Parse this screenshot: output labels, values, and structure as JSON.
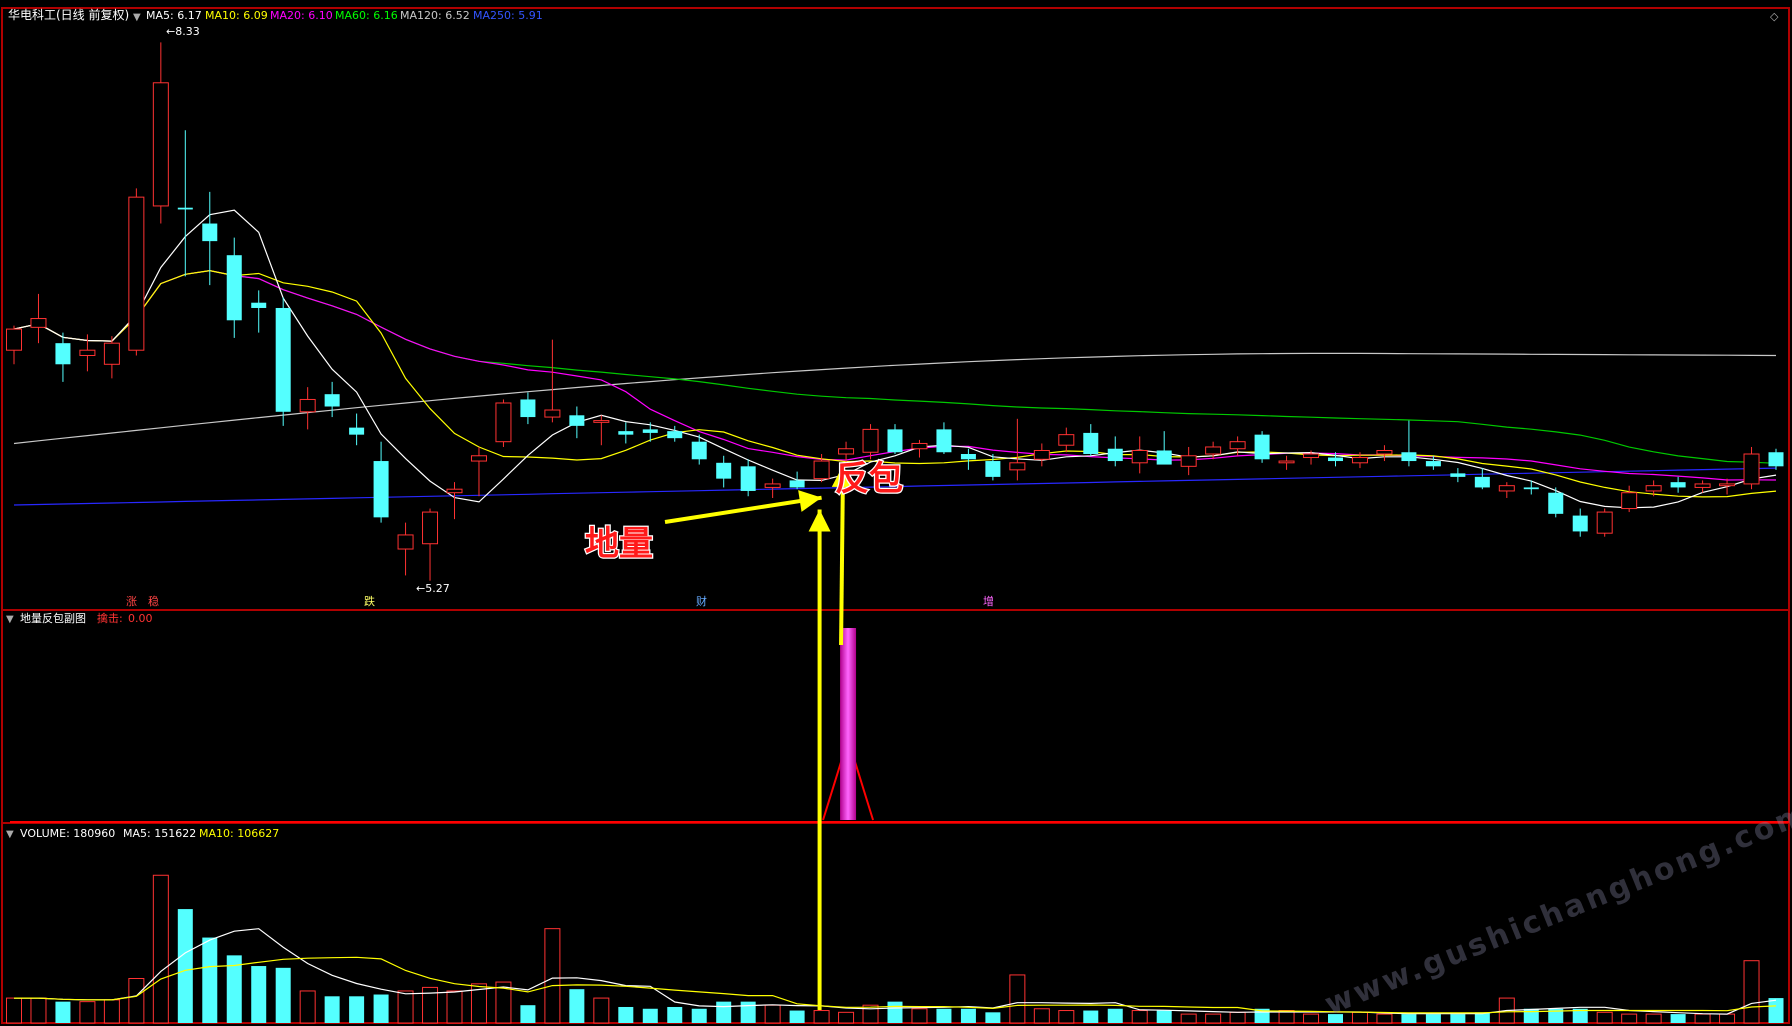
{
  "main_panel": {
    "stock_name": "华电科工(日线 前复权)",
    "ma_values": [
      {
        "label": "MA5: 6.17",
        "color": "#ffffff"
      },
      {
        "label": "MA10: 6.09",
        "color": "#ffff00"
      },
      {
        "label": "MA20: 6.10",
        "color": "#ff00ff"
      },
      {
        "label": "MA60: 6.16",
        "color": "#00ff00"
      },
      {
        "label": "MA120: 6.52",
        "color": "#c8c8c8"
      },
      {
        "label": "MA250: 5.91",
        "color": "#3355ff"
      }
    ],
    "high_label": "8.33",
    "low_label": "5.27",
    "event_marks": [
      "涨",
      "稳",
      "跌",
      "财",
      "增"
    ]
  },
  "indicator_panel": {
    "title": "地量反包副图",
    "field_label": "擒击:",
    "field_value": "0.00"
  },
  "volume_panel": {
    "volume_label": "VOLUME: 180960",
    "ma5_label": "MA5: 151622",
    "ma10_label": "MA10: 106627"
  },
  "annotations": {
    "left": "地量",
    "right": "反包"
  },
  "watermark": "www.gushichanghong.com",
  "colors": {
    "up": "#ff3232",
    "down": "#54ffff",
    "ma5": "#ffffff",
    "ma10": "#ffff00",
    "ma20": "#ff00ff",
    "ma60": "#00c800",
    "ma120": "#c8c8c8",
    "ma250": "#2828ff",
    "signal": "#ff00ff",
    "arrow": "#ffff00",
    "annotation": "#ff1a1a"
  },
  "chart_data": [
    {
      "type": "candlestick",
      "title": "华电科工(日线 前复权)",
      "y_axis_range_approx": [
        5.0,
        8.5
      ],
      "price_high_label": 8.33,
      "price_low_label": 5.27,
      "series": [
        {
          "name": "MA5",
          "last": 6.17
        },
        {
          "name": "MA10",
          "last": 6.09
        },
        {
          "name": "MA20",
          "last": 6.1
        },
        {
          "name": "MA60",
          "last": 6.16
        },
        {
          "name": "MA120",
          "last": 6.52
        },
        {
          "name": "MA250",
          "last": 5.91
        }
      ],
      "candles_ohlc": [
        [
          6.58,
          6.72,
          6.5,
          6.7
        ],
        [
          6.71,
          6.9,
          6.62,
          6.76
        ],
        [
          6.62,
          6.68,
          6.4,
          6.5
        ],
        [
          6.55,
          6.67,
          6.46,
          6.58
        ],
        [
          6.5,
          6.66,
          6.42,
          6.62
        ],
        [
          6.58,
          7.5,
          6.55,
          7.45
        ],
        [
          7.4,
          8.33,
          7.3,
          8.1
        ],
        [
          7.39,
          7.83,
          7.0,
          7.38
        ],
        [
          7.3,
          7.48,
          6.95,
          7.2
        ],
        [
          7.12,
          7.22,
          6.65,
          6.75
        ],
        [
          6.85,
          6.92,
          6.68,
          6.82
        ],
        [
          6.82,
          6.88,
          6.15,
          6.23
        ],
        [
          6.23,
          6.37,
          6.13,
          6.3
        ],
        [
          6.33,
          6.4,
          6.2,
          6.26
        ],
        [
          6.14,
          6.22,
          6.04,
          6.1
        ],
        [
          5.95,
          6.06,
          5.6,
          5.63
        ],
        [
          5.45,
          5.6,
          5.3,
          5.53
        ],
        [
          5.48,
          5.68,
          5.27,
          5.66
        ],
        [
          5.77,
          5.83,
          5.62,
          5.79
        ],
        [
          5.95,
          6.03,
          5.75,
          5.98
        ],
        [
          6.06,
          6.3,
          6.03,
          6.28
        ],
        [
          6.3,
          6.34,
          6.16,
          6.2
        ],
        [
          6.2,
          6.64,
          6.17,
          6.24
        ],
        [
          6.21,
          6.26,
          6.08,
          6.15
        ],
        [
          6.17,
          6.21,
          6.04,
          6.18
        ],
        [
          6.12,
          6.17,
          6.05,
          6.1
        ],
        [
          6.13,
          6.17,
          6.06,
          6.11
        ],
        [
          6.12,
          6.15,
          6.06,
          6.08
        ],
        [
          6.06,
          6.1,
          5.93,
          5.96
        ],
        [
          5.94,
          5.98,
          5.8,
          5.85
        ],
        [
          5.92,
          5.96,
          5.75,
          5.78
        ],
        [
          5.8,
          5.85,
          5.74,
          5.82
        ],
        [
          5.84,
          5.89,
          5.79,
          5.8
        ],
        [
          5.85,
          5.99,
          5.83,
          5.95
        ],
        [
          5.99,
          6.06,
          5.93,
          6.02
        ],
        [
          6.0,
          6.16,
          5.96,
          6.13
        ],
        [
          6.13,
          6.16,
          5.99,
          6.0
        ],
        [
          6.02,
          6.07,
          5.97,
          6.05
        ],
        [
          6.13,
          6.17,
          5.99,
          6.0
        ],
        [
          5.99,
          6.02,
          5.9,
          5.96
        ],
        [
          5.95,
          5.99,
          5.84,
          5.86
        ],
        [
          5.9,
          6.19,
          5.84,
          5.94
        ],
        [
          5.96,
          6.05,
          5.92,
          6.01
        ],
        [
          6.04,
          6.14,
          6.0,
          6.1
        ],
        [
          6.11,
          6.16,
          5.98,
          5.99
        ],
        [
          6.02,
          6.09,
          5.92,
          5.95
        ],
        [
          5.94,
          6.09,
          5.88,
          6.01
        ],
        [
          6.01,
          6.12,
          5.98,
          5.93
        ],
        [
          5.92,
          6.03,
          5.87,
          5.98
        ],
        [
          5.99,
          6.06,
          5.96,
          6.03
        ],
        [
          6.02,
          6.09,
          5.98,
          6.06
        ],
        [
          6.1,
          6.12,
          5.94,
          5.96
        ],
        [
          5.94,
          5.98,
          5.9,
          5.95
        ],
        [
          5.97,
          6.01,
          5.93,
          5.99
        ],
        [
          5.97,
          6.0,
          5.92,
          5.95
        ],
        [
          5.94,
          6.0,
          5.91,
          5.97
        ],
        [
          5.99,
          6.04,
          5.95,
          6.01
        ],
        [
          6.0,
          6.18,
          5.92,
          5.95
        ],
        [
          5.95,
          5.98,
          5.9,
          5.92
        ],
        [
          5.88,
          5.91,
          5.83,
          5.86
        ],
        [
          5.86,
          5.91,
          5.79,
          5.8
        ],
        [
          5.78,
          5.83,
          5.74,
          5.81
        ],
        [
          5.8,
          5.84,
          5.76,
          5.79
        ],
        [
          5.77,
          5.8,
          5.63,
          5.65
        ],
        [
          5.64,
          5.68,
          5.52,
          5.55
        ],
        [
          5.54,
          5.68,
          5.52,
          5.66
        ],
        [
          5.68,
          5.81,
          5.66,
          5.77
        ],
        [
          5.78,
          5.84,
          5.75,
          5.81
        ],
        [
          5.83,
          5.86,
          5.77,
          5.8
        ],
        [
          5.8,
          5.84,
          5.77,
          5.82
        ],
        [
          5.81,
          5.85,
          5.76,
          5.82
        ],
        [
          5.82,
          6.03,
          5.79,
          5.99
        ],
        [
          6.0,
          6.02,
          5.9,
          5.92
        ]
      ]
    },
    {
      "type": "bar",
      "title": "地量反包副图",
      "series": [
        {
          "name": "擒击",
          "last": 0.0
        }
      ],
      "signal_bar_index": 34,
      "signal_bar_value_fraction": 1.0
    },
    {
      "type": "bar",
      "title": "VOLUME",
      "series": [
        {
          "name": "VOLUME",
          "last": 180960
        },
        {
          "name": "MA5",
          "last": 151622
        },
        {
          "name": "MA10",
          "last": 106627
        }
      ],
      "volume_relative": [
        0.14,
        0.14,
        0.12,
        0.12,
        0.13,
        0.25,
        0.83,
        0.64,
        0.48,
        0.38,
        0.32,
        0.31,
        0.18,
        0.15,
        0.15,
        0.16,
        0.18,
        0.2,
        0.18,
        0.22,
        0.23,
        0.1,
        0.53,
        0.19,
        0.14,
        0.09,
        0.08,
        0.09,
        0.08,
        0.12,
        0.12,
        0.1,
        0.07,
        0.07,
        0.06,
        0.1,
        0.12,
        0.08,
        0.08,
        0.08,
        0.06,
        0.27,
        0.08,
        0.07,
        0.07,
        0.08,
        0.07,
        0.07,
        0.05,
        0.05,
        0.06,
        0.08,
        0.07,
        0.05,
        0.05,
        0.06,
        0.05,
        0.05,
        0.05,
        0.05,
        0.06,
        0.14,
        0.08,
        0.08,
        0.08,
        0.06,
        0.05,
        0.05,
        0.05,
        0.05,
        0.05,
        0.35,
        0.14
      ]
    }
  ]
}
